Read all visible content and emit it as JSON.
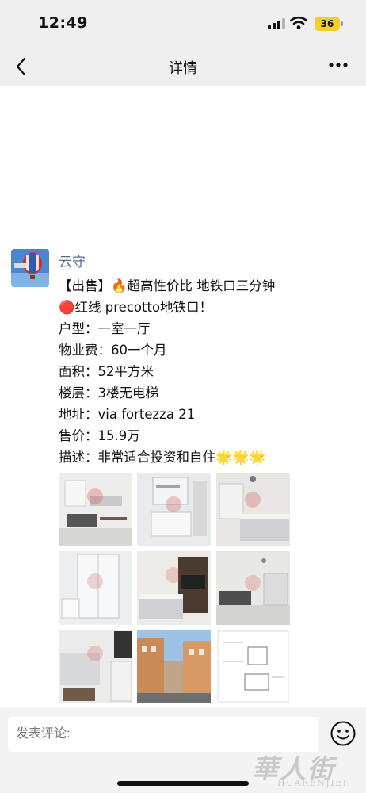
{
  "status": {
    "time": "12:49",
    "battery": "36"
  },
  "nav": {
    "title": "详情"
  },
  "post": {
    "author": "云守",
    "lines": [
      "【出售】🔥超高性价比 地铁口三分钟",
      "🔴红线 precotto地铁口！",
      "户型：一室一厅",
      "物业费：60一个月",
      "面积：52平方米",
      "楼层：3楼无电梯",
      "地址：via fortezza 21",
      "售价：15.9万",
      "描述：非常适合投资和自住"
    ],
    "stars": "🌟🌟🌟"
  },
  "comment": {
    "placeholder": "发表评论:"
  },
  "watermark": {
    "main": "華人街",
    "sub": "HUARENJIEI"
  },
  "colors": {
    "author": "#5a6b94",
    "bar_bg": "#efefef",
    "battery": "#f4cf2a"
  },
  "icons": [
    "back-arrow-icon",
    "more-dots-icon",
    "signal-icon",
    "wifi-icon",
    "battery-icon",
    "emoji-icon"
  ]
}
